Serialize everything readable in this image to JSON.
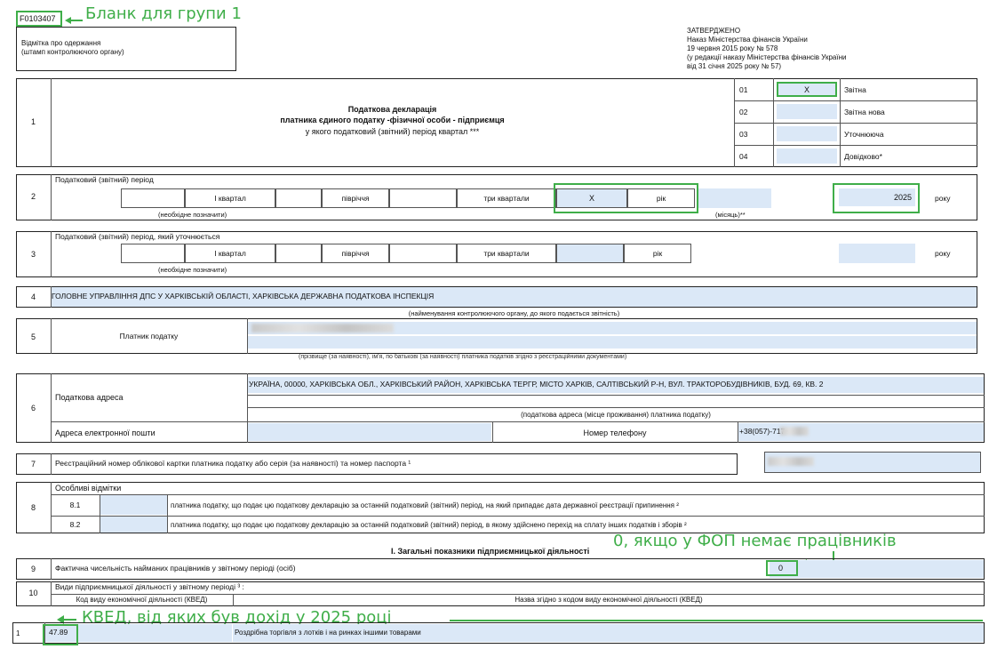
{
  "header": {
    "form_code": "F0103407",
    "annotation_form": "Бланк для групи 1",
    "stamp_label_line1": "Відмітка про одержання",
    "stamp_label_line2": "(штамп контролюючого органу)",
    "approved_lines": [
      "ЗАТВЕРДЖЕНО",
      "Наказ Міністерства фінансів України",
      "19 червня 2015 року № 578",
      "(у редакції наказу Міністерства фінансів України",
      "від 31 січня 2025 року № 57)"
    ]
  },
  "section1": {
    "num": "1",
    "title": "Податкова декларація",
    "subtitle": "платника єдиного податку -фізичної особи - підприємця",
    "period_note": "у якого податковий (звітний) період квартал ***",
    "types": [
      {
        "code": "01",
        "mark": "X",
        "label": "Звітна"
      },
      {
        "code": "02",
        "mark": "",
        "label": "Звітна нова"
      },
      {
        "code": "03",
        "mark": "",
        "label": "Уточнююча"
      },
      {
        "code": "04",
        "mark": "",
        "label": "Довідково*"
      }
    ]
  },
  "section2": {
    "num": "2",
    "label": "Податковий (звітний) період",
    "q1": "I квартал",
    "half": "півріччя",
    "q3": "три квартали",
    "mark": "X",
    "year_label": "рік",
    "mark_note": "(необхідне позначити)",
    "month_note": "(місяць)**",
    "year_value": "2025",
    "year_word": "року"
  },
  "section3": {
    "num": "3",
    "label": "Податковий (звітний) період, який уточнюється",
    "q1": "I квартал",
    "half": "півріччя",
    "q3": "три квартали",
    "year_label": "рік",
    "mark_note": "(необхідне позначити)",
    "year_word": "року"
  },
  "section4": {
    "num": "4",
    "value": "ГОЛОВНЕ УПРАВЛІННЯ ДПС У ХАРКІВСЬКІЙ ОБЛАСТІ, ХАРКІВСЬКА ДЕРЖАВНА ПОДАТКОВА ІНСПЕКЦІЯ",
    "note": "(найменування контролюючого органу, до якого подається звітність)"
  },
  "section5": {
    "num": "5",
    "label": "Платник податку",
    "note": "(прізвище (за наявності), ім'я, по батькові (за наявності) платника податків згідно з реєстраційними документами)"
  },
  "section6": {
    "num": "6",
    "address_label": "Податкова адреса",
    "address_value": "УКРАЇНА, 00000, ХАРКІВСЬКА ОБЛ., ХАРКІВСЬКИЙ РАЙОН, ХАРКІВСЬКА ТЕРГР, МІСТО ХАРКІВ, САЛТІВСЬКИЙ Р-Н, ВУЛ. ТРАКТОРОБУДІВНИКІВ, БУД. 69, КВ. 2",
    "address_note": "(податкова адреса (місце проживання) платника податку)",
    "email_label": "Адреса електронної пошти",
    "phone_label": "Номер телефону",
    "phone_value": "+38(057)-717"
  },
  "section7": {
    "num": "7",
    "label": "Реєстраційний номер облікової картки платника податку або серія (за наявності) та номер паспорта ¹"
  },
  "section8": {
    "num": "8",
    "label": "Особливі відмітки",
    "rows": [
      {
        "code": "8.1",
        "text": "платника податку, що подає цю податкову декларацію за останній податковий (звітний) період, на який припадає дата державної реєстрації припинення ²"
      },
      {
        "code": "8.2",
        "text": "платника податку, що подає цю податкову декларацію за останній податковий (звітний) період, в якому здійснено перехід на сплату інших податків і зборів ²"
      }
    ]
  },
  "part1_title": "I. Загальні показники підприємницької діяльності",
  "annotation_zero": "0, якщо у ФОП немає працівників",
  "section9": {
    "num": "9",
    "label": "Фактична чисельність найманих працівників у звітному періоді (осіб)",
    "value": "0"
  },
  "section10": {
    "num": "10",
    "label": "Види підприємницької діяльності у звітному періоді ³ :",
    "col1": "Код виду економічної діяльності (КВЕД)",
    "col2": "Назва згідно з кодом виду економічної діяльності (КВЕД)"
  },
  "annotation_kved": "КВЕД, від яких був дохід у 2025 році",
  "kved_row": {
    "num": "1",
    "code": "47.89",
    "name": "Роздрібна торгівля з лотків і на ринках іншими товарами"
  },
  "colors": {
    "annotation": "#3fae49",
    "field_fill": "#dbe8f7"
  }
}
